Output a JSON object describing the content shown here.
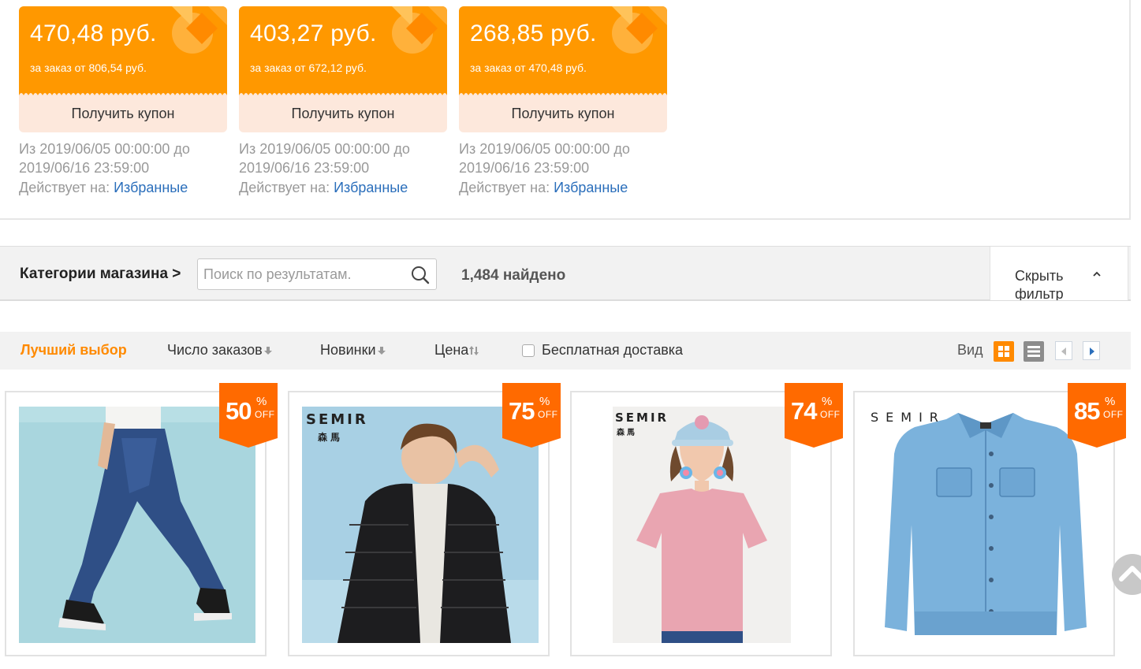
{
  "coupons": [
    {
      "amount": "470,48 руб.",
      "condition": "за заказ от 806,54 руб.",
      "button": "Получить купон",
      "date_from": "Из 2019/06/05 00:00:00 до",
      "date_to": "2019/06/16 23:59:00",
      "applies_label": "Действует на:",
      "applies_link": "Избранные"
    },
    {
      "amount": "403,27 руб.",
      "condition": "за заказ от 672,12 руб.",
      "button": "Получить купон",
      "date_from": "Из 2019/06/05 00:00:00 до",
      "date_to": "2019/06/16 23:59:00",
      "applies_label": "Действует на:",
      "applies_link": "Избранные"
    },
    {
      "amount": "268,85 руб.",
      "condition": "за заказ от 470,48 руб.",
      "button": "Получить купон",
      "date_from": "Из 2019/06/05 00:00:00 до",
      "date_to": "2019/06/16 23:59:00",
      "applies_label": "Действует на:",
      "applies_link": "Избранные"
    }
  ],
  "filter": {
    "categories_label": "Категории магазина >",
    "search_placeholder": "Поиск по результатам.",
    "found": "1,484 найдено",
    "hide_filter": "Скрыть фильтр"
  },
  "sort": {
    "best": "Лучший выбор",
    "orders": "Число заказов",
    "new": "Новинки",
    "price": "Цена",
    "free_shipping": "Бесплатная доставка",
    "view_label": "Вид"
  },
  "products": [
    {
      "discount": "50",
      "pct": "%",
      "off": "OFF",
      "icon": "jeans-model-photo"
    },
    {
      "discount": "75",
      "pct": "%",
      "off": "OFF",
      "icon": "puffer-jacket-model-photo",
      "brand": "SEMIR",
      "brand_cn": "森馬"
    },
    {
      "discount": "74",
      "pct": "%",
      "off": "OFF",
      "icon": "pink-tshirt-model-photo",
      "brand": "SEMIR",
      "brand_cn": "森馬"
    },
    {
      "discount": "85",
      "pct": "%",
      "off": "OFF",
      "icon": "denim-jacket-photo",
      "brand": "SEMIR"
    }
  ],
  "colors": {
    "accent": "#ff8a00",
    "coupon": "#ff9800",
    "badge": "#ff6a00",
    "link": "#2a6ebb"
  }
}
